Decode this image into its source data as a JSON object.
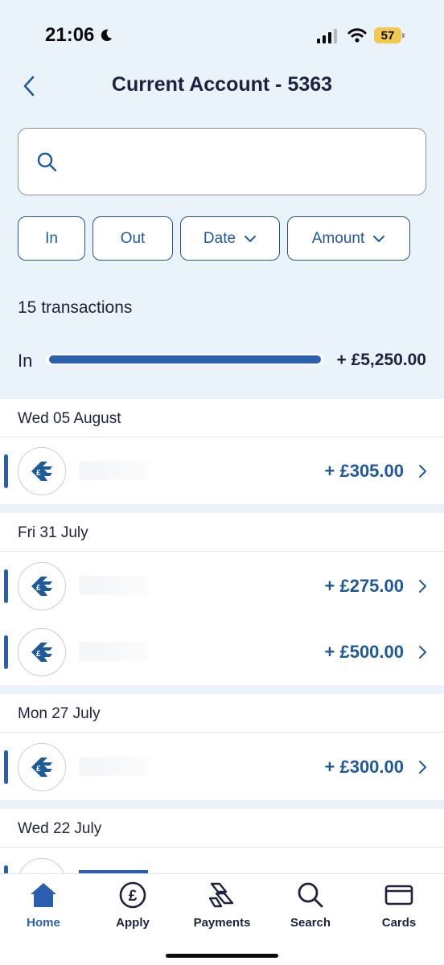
{
  "status": {
    "time": "21:06",
    "battery": "57"
  },
  "header": {
    "title": "Current Account - 5363"
  },
  "search": {
    "placeholder": ""
  },
  "filters": {
    "in": "In",
    "out": "Out",
    "date": "Date",
    "amount": "Amount"
  },
  "summary": {
    "count": "15 transactions",
    "in_label": "In",
    "in_total": "+ £5,250.00",
    "in_fill_fraction": 1.0
  },
  "days": [
    {
      "label": "Wed 05 August",
      "transactions": [
        {
          "amount": "+ £305.00"
        }
      ]
    },
    {
      "label": "Fri 31 July",
      "transactions": [
        {
          "amount": "+ £275.00"
        },
        {
          "amount": "+ £500.00"
        }
      ]
    },
    {
      "label": "Mon 27 July",
      "transactions": [
        {
          "amount": "+ £300.00"
        }
      ]
    },
    {
      "label": "Wed 22 July",
      "transactions": []
    }
  ],
  "tabs": [
    {
      "label": "Home",
      "icon": "home-icon",
      "active": true
    },
    {
      "label": "Apply",
      "icon": "pound-circle-icon"
    },
    {
      "label": "Payments",
      "icon": "payments-icon"
    },
    {
      "label": "Search",
      "icon": "search-icon"
    },
    {
      "label": "Cards",
      "icon": "card-icon"
    }
  ],
  "colors": {
    "accent": "#2a5fb0",
    "background": "#eaf2fa",
    "text": "#1b2340"
  }
}
